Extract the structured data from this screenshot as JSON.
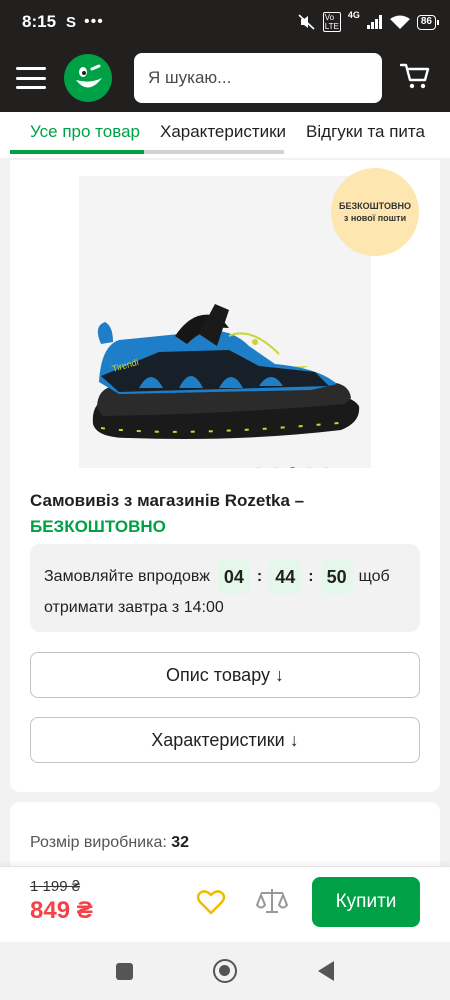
{
  "status_bar": {
    "time": "8:15",
    "app_indicator": "S",
    "more": "•••",
    "network_label": "4G",
    "battery": "86"
  },
  "header": {
    "search_placeholder": "Я шукаю...",
    "icons": [
      "menu-icon",
      "rozetka-logo",
      "microphone-icon",
      "cart-icon"
    ]
  },
  "tabs": [
    {
      "label": "Усе про товар",
      "active": true
    },
    {
      "label": "Характеристики",
      "active": false
    },
    {
      "label": "Відгуки та пита",
      "active": false
    }
  ],
  "product": {
    "badge_line1": "БЕЗКОШТОВНО",
    "badge_line2": "з нової пошти",
    "image_brand": "Tirendi",
    "gallery_total": 5,
    "gallery_active": 3
  },
  "delivery": {
    "pickup_text": "Самовивіз з магазинів Rozetka –",
    "pickup_free": "БЕЗКОШТОВНО"
  },
  "timer": {
    "prefix": "Замовляйте впродовж",
    "hours": "04",
    "minutes": "44",
    "seconds": "50",
    "suffix": "щоб",
    "line2": "отримати завтра з 14:00"
  },
  "buttons": {
    "description": "Опис товару ↓",
    "characteristics": "Характеристики ↓",
    "buy": "Купити"
  },
  "size": {
    "label": "Розмір виробника:",
    "value": "32"
  },
  "price": {
    "old": "1 199 ₴",
    "current": "849 ₴"
  },
  "colors": {
    "brand_green": "#00a046",
    "price_red": "#f84147",
    "header_dark": "#221f1f",
    "heart_yellow": "#f5b800"
  }
}
